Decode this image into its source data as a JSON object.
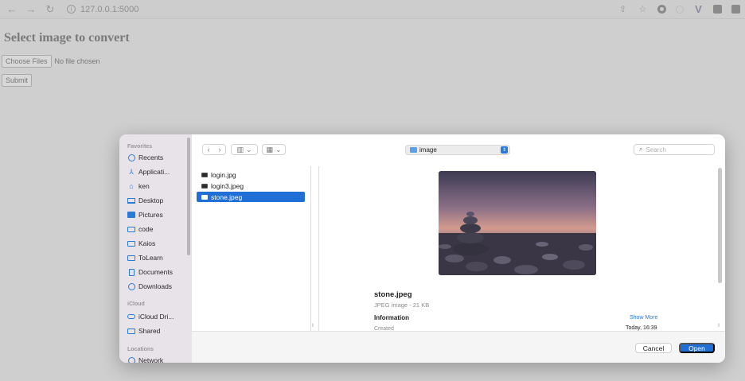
{
  "browser": {
    "url": "127.0.0.1:5000",
    "nav_icons": [
      "back-icon",
      "forward-icon",
      "reload-icon"
    ],
    "extension_icons": [
      "share-icon",
      "bookmark-star-icon",
      "opera-icon",
      "circle-extension-icon",
      "vivaldi-icon",
      "extension-icon",
      "extension-puzzle-icon"
    ]
  },
  "page": {
    "title": "Select image to convert",
    "choose_files_label": "Choose Files",
    "no_file_label": "No file chosen",
    "submit_label": "Submit"
  },
  "dialog": {
    "sidebar": {
      "favorites_heading": "Favorites",
      "favorites": [
        {
          "label": "Recents",
          "icon": "clock-icon"
        },
        {
          "label": "Applicati...",
          "icon": "applications-icon"
        },
        {
          "label": "ken",
          "icon": "home-icon"
        },
        {
          "label": "Desktop",
          "icon": "desktop-icon"
        },
        {
          "label": "Pictures",
          "icon": "pictures-icon"
        },
        {
          "label": "code",
          "icon": "folder-icon"
        },
        {
          "label": "Kaios",
          "icon": "folder-icon"
        },
        {
          "label": "ToLearn",
          "icon": "folder-icon"
        },
        {
          "label": "Documents",
          "icon": "document-icon"
        },
        {
          "label": "Downloads",
          "icon": "download-icon"
        }
      ],
      "icloud_heading": "iCloud",
      "icloud": [
        {
          "label": "iCloud Dri...",
          "icon": "cloud-icon"
        },
        {
          "label": "Shared",
          "icon": "shared-folder-icon"
        }
      ],
      "locations_heading": "Locations",
      "locations": [
        {
          "label": "Network",
          "icon": "globe-icon"
        }
      ]
    },
    "toolbar": {
      "folder_name": "image",
      "search_placeholder": "Search"
    },
    "files": [
      {
        "name": "login.jpg",
        "selected": false
      },
      {
        "name": "login3.jpeg",
        "selected": false
      },
      {
        "name": "stone.jpeg",
        "selected": true
      }
    ],
    "preview": {
      "file_name": "stone.jpeg",
      "kind_size": "JPEG image - 21 KB",
      "information_label": "Information",
      "show_more_label": "Show More",
      "created_label": "Created",
      "created_value": "Today, 16:39"
    },
    "footer": {
      "cancel_label": "Cancel",
      "open_label": "Open"
    },
    "colors": {
      "accent": "#1f6fd6",
      "sidebar_bg": "#e7e3e8"
    }
  }
}
